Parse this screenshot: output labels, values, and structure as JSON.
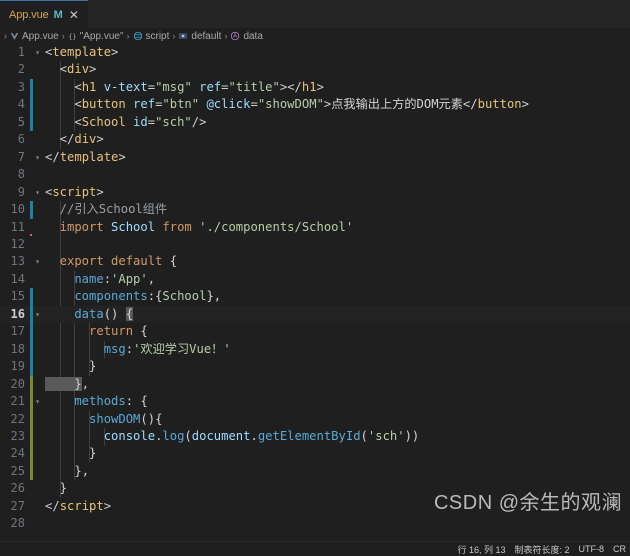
{
  "window": {
    "theme_bg": "#1f1f1f",
    "accent": "#3d6ea5"
  },
  "tabbar": {
    "tabs": [
      {
        "label": "App.vue",
        "dirty_indicator": "M",
        "close_glyph": "✕",
        "active": true
      }
    ]
  },
  "breadcrumb": {
    "separator": "›",
    "leading_separator": "›",
    "items": [
      {
        "icon": "vue-file-icon",
        "label": "App.vue"
      },
      {
        "icon": "braces-icon",
        "label": "\"App.vue\""
      },
      {
        "icon": "module-icon",
        "label": "script"
      },
      {
        "icon": "export-icon",
        "label": "default"
      },
      {
        "icon": "property-icon",
        "label": "data"
      }
    ]
  },
  "editor": {
    "language": "vue",
    "current_line": 16,
    "lines": [
      {
        "n": 1,
        "indent": 0,
        "change": "",
        "fold": "▾",
        "tokens": [
          {
            "t": "punct",
            "v": "<"
          },
          {
            "t": "tag",
            "v": "template"
          },
          {
            "t": "punct",
            "v": ">"
          }
        ]
      },
      {
        "n": 2,
        "indent": 1,
        "change": "",
        "fold": "",
        "tokens": [
          {
            "t": "punct",
            "v": "  <"
          },
          {
            "t": "tag",
            "v": "div"
          },
          {
            "t": "punct",
            "v": ">"
          }
        ]
      },
      {
        "n": 3,
        "indent": 2,
        "change": "mod",
        "fold": "",
        "tokens": [
          {
            "t": "punct",
            "v": "    <"
          },
          {
            "t": "tag",
            "v": "h1"
          },
          {
            "t": "attr",
            "v": " v-text"
          },
          {
            "t": "punct",
            "v": "="
          },
          {
            "t": "str",
            "v": "\"msg\""
          },
          {
            "t": "attr",
            "v": " ref"
          },
          {
            "t": "punct",
            "v": "="
          },
          {
            "t": "str",
            "v": "\"title\""
          },
          {
            "t": "punct",
            "v": "></"
          },
          {
            "t": "tag",
            "v": "h1"
          },
          {
            "t": "punct",
            "v": ">"
          }
        ]
      },
      {
        "n": 4,
        "indent": 2,
        "change": "mod",
        "fold": "",
        "tokens": [
          {
            "t": "punct",
            "v": "    <"
          },
          {
            "t": "tag",
            "v": "button"
          },
          {
            "t": "attr",
            "v": " ref"
          },
          {
            "t": "punct",
            "v": "="
          },
          {
            "t": "str",
            "v": "\"btn\""
          },
          {
            "t": "attr",
            "v": " @click"
          },
          {
            "t": "punct",
            "v": "="
          },
          {
            "t": "str",
            "v": "\"showDOM\""
          },
          {
            "t": "punct",
            "v": ">"
          },
          {
            "t": "text",
            "v": "点我输出上方的DOM元素"
          },
          {
            "t": "punct",
            "v": "</"
          },
          {
            "t": "tag",
            "v": "button"
          },
          {
            "t": "punct",
            "v": ">"
          }
        ]
      },
      {
        "n": 5,
        "indent": 2,
        "change": "mod",
        "fold": "",
        "tokens": [
          {
            "t": "punct",
            "v": "    <"
          },
          {
            "t": "tag",
            "v": "School"
          },
          {
            "t": "attr",
            "v": " id"
          },
          {
            "t": "punct",
            "v": "="
          },
          {
            "t": "str",
            "v": "\"sch\""
          },
          {
            "t": "punct",
            "v": "/>"
          }
        ]
      },
      {
        "n": 6,
        "indent": 1,
        "change": "",
        "fold": "",
        "tokens": [
          {
            "t": "punct",
            "v": "  </"
          },
          {
            "t": "tag",
            "v": "div"
          },
          {
            "t": "punct",
            "v": ">"
          }
        ]
      },
      {
        "n": 7,
        "indent": 0,
        "change": "",
        "fold": "▾",
        "tokens": [
          {
            "t": "punct",
            "v": "</"
          },
          {
            "t": "tag",
            "v": "template"
          },
          {
            "t": "punct",
            "v": ">"
          }
        ]
      },
      {
        "n": 8,
        "indent": 0,
        "change": "",
        "fold": "",
        "tokens": []
      },
      {
        "n": 9,
        "indent": 0,
        "change": "",
        "fold": "▾",
        "tokens": [
          {
            "t": "punct",
            "v": "<"
          },
          {
            "t": "tag",
            "v": "script"
          },
          {
            "t": "punct",
            "v": ">"
          }
        ]
      },
      {
        "n": 10,
        "indent": 1,
        "change": "mod",
        "fold": "",
        "tokens": [
          {
            "t": "cmt",
            "v": "  //引入School组件"
          }
        ]
      },
      {
        "n": 11,
        "indent": 1,
        "change": "",
        "fold": "",
        "tokens": [
          {
            "t": "kw",
            "v": "  import"
          },
          {
            "t": "ident",
            "v": " School"
          },
          {
            "t": "kw",
            "v": " from"
          },
          {
            "t": "cls",
            "v": " './components/School'"
          }
        ]
      },
      {
        "n": 12,
        "indent": 1,
        "change": "",
        "fold": "",
        "tokens": []
      },
      {
        "n": 13,
        "indent": 1,
        "change": "",
        "fold": "▾",
        "tokens": [
          {
            "t": "kw",
            "v": "  export default"
          },
          {
            "t": "brk",
            "v": " {"
          }
        ]
      },
      {
        "n": 14,
        "indent": 2,
        "change": "",
        "fold": "",
        "tokens": [
          {
            "t": "prop",
            "v": "    name"
          },
          {
            "t": "punct",
            "v": ":"
          },
          {
            "t": "cls",
            "v": "'App'"
          },
          {
            "t": "punct",
            "v": ","
          }
        ]
      },
      {
        "n": 15,
        "indent": 2,
        "change": "mod",
        "fold": "",
        "tokens": [
          {
            "t": "prop",
            "v": "    components"
          },
          {
            "t": "punct",
            "v": ":"
          },
          {
            "t": "brk",
            "v": "{"
          },
          {
            "t": "cls",
            "v": "School"
          },
          {
            "t": "brk",
            "v": "}"
          },
          {
            "t": "punct",
            "v": ","
          }
        ]
      },
      {
        "n": 16,
        "indent": 2,
        "change": "mod",
        "fold": "▾",
        "tokens": [
          {
            "t": "prop",
            "v": "    data"
          },
          {
            "t": "brk",
            "v": "() "
          },
          {
            "t": "brk-hl",
            "v": "{"
          }
        ]
      },
      {
        "n": 17,
        "indent": 3,
        "change": "mod",
        "fold": "",
        "tokens": [
          {
            "t": "kw",
            "v": "      return"
          },
          {
            "t": "brk",
            "v": " {"
          }
        ]
      },
      {
        "n": 18,
        "indent": 4,
        "change": "mod",
        "fold": "",
        "tokens": [
          {
            "t": "prop",
            "v": "        msg"
          },
          {
            "t": "punct",
            "v": ":"
          },
          {
            "t": "cls",
            "v": "'欢迎学习Vue！'"
          }
        ]
      },
      {
        "n": 19,
        "indent": 3,
        "change": "mod",
        "fold": "",
        "tokens": [
          {
            "t": "brk",
            "v": "      }"
          }
        ]
      },
      {
        "n": 20,
        "indent": 2,
        "change": "add",
        "fold": "",
        "tokens": [
          {
            "t": "brk-hl",
            "v": "    }"
          },
          {
            "t": "punct",
            "v": ","
          }
        ]
      },
      {
        "n": 21,
        "indent": 2,
        "change": "add",
        "fold": "▾",
        "tokens": [
          {
            "t": "prop",
            "v": "    methods"
          },
          {
            "t": "punct",
            "v": ": "
          },
          {
            "t": "brk",
            "v": "{"
          }
        ]
      },
      {
        "n": 22,
        "indent": 3,
        "change": "add",
        "fold": "",
        "tokens": [
          {
            "t": "fn",
            "v": "      showDOM"
          },
          {
            "t": "brk",
            "v": "(){"
          }
        ]
      },
      {
        "n": 23,
        "indent": 4,
        "change": "add",
        "fold": "",
        "tokens": [
          {
            "t": "ident",
            "v": "        console"
          },
          {
            "t": "punct",
            "v": "."
          },
          {
            "t": "fn",
            "v": "log"
          },
          {
            "t": "brk",
            "v": "("
          },
          {
            "t": "ident",
            "v": "document"
          },
          {
            "t": "punct",
            "v": "."
          },
          {
            "t": "fn",
            "v": "getElementById"
          },
          {
            "t": "brk",
            "v": "("
          },
          {
            "t": "cls",
            "v": "'sch'"
          },
          {
            "t": "brk",
            "v": "))"
          }
        ]
      },
      {
        "n": 24,
        "indent": 3,
        "change": "add",
        "fold": "",
        "tokens": [
          {
            "t": "brk",
            "v": "      }"
          }
        ]
      },
      {
        "n": 25,
        "indent": 2,
        "change": "add",
        "fold": "",
        "tokens": [
          {
            "t": "brk",
            "v": "    }"
          },
          {
            "t": "punct",
            "v": ","
          }
        ]
      },
      {
        "n": 26,
        "indent": 1,
        "change": "",
        "fold": "",
        "tokens": [
          {
            "t": "brk",
            "v": "  }"
          }
        ]
      },
      {
        "n": 27,
        "indent": 0,
        "change": "",
        "fold": "",
        "tokens": [
          {
            "t": "punct",
            "v": "</"
          },
          {
            "t": "tag",
            "v": "script"
          },
          {
            "t": "punct",
            "v": ">"
          }
        ]
      },
      {
        "n": 28,
        "indent": 0,
        "change": "",
        "fold": "",
        "tokens": []
      }
    ]
  },
  "watermark": {
    "text": "CSDN @余生的观澜"
  },
  "statusbar": {
    "items": [
      {
        "name": "cursor-position",
        "label": "行 16, 列 13"
      },
      {
        "name": "indentation",
        "label": "制表符长度: 2"
      },
      {
        "name": "encoding",
        "label": "UTF-8"
      },
      {
        "name": "eol",
        "label": "CR"
      }
    ]
  }
}
